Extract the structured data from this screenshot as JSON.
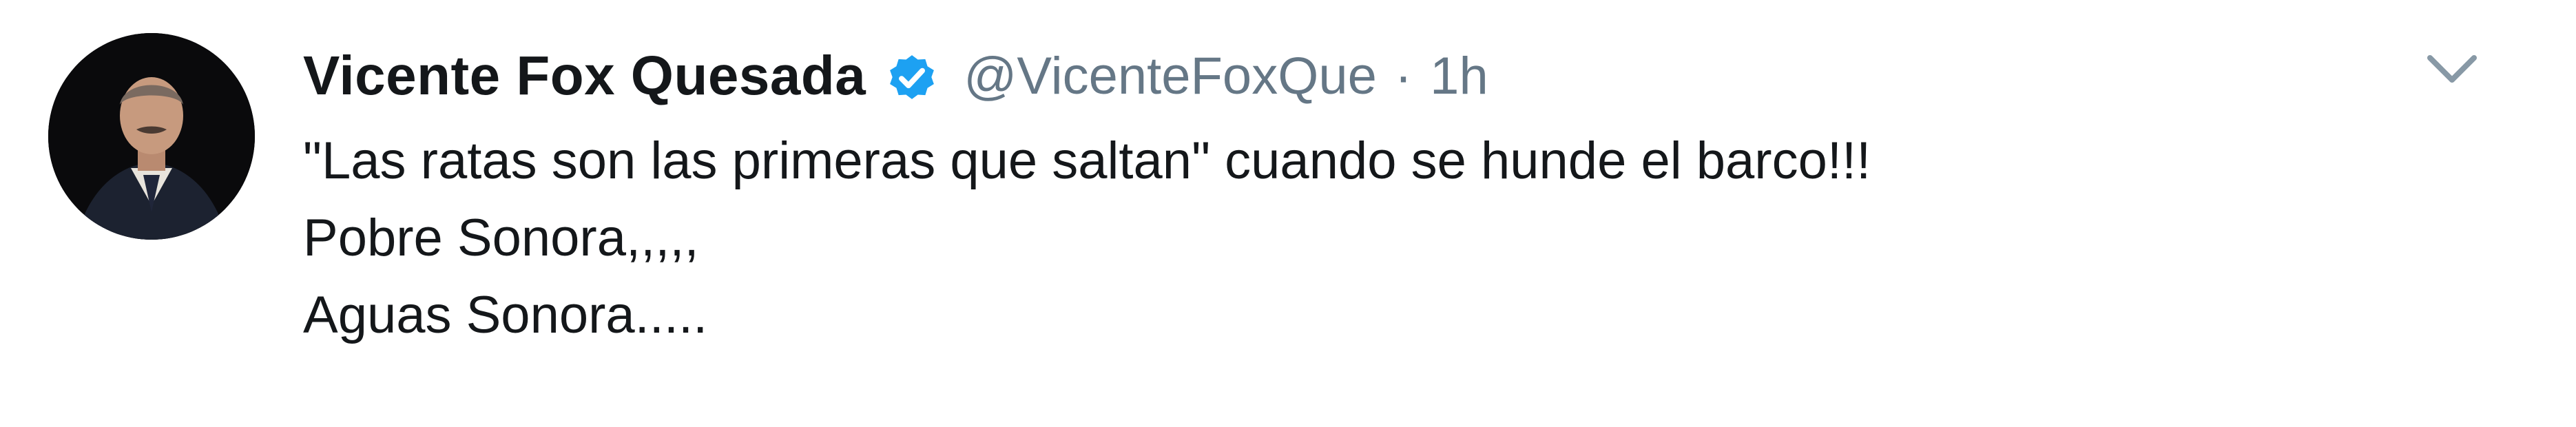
{
  "tweet": {
    "display_name": "Vicente Fox Quesada",
    "handle": "@VicenteFoxQue",
    "separator": "·",
    "time": "1h",
    "verified_icon": "verified-badge-icon",
    "menu_icon": "chevron-down-icon",
    "avatar_icon": "profile-photo",
    "text_lines": [
      "\"Las ratas son las primeras que saltan\" cuando se hunde el barco!!!",
      "Pobre Sonora,,,,,",
      "Aguas Sonora....."
    ]
  },
  "colors": {
    "verified": "#1da1f2",
    "name": "#14171a",
    "secondary": "#657786",
    "chevron": "#8899a6"
  }
}
